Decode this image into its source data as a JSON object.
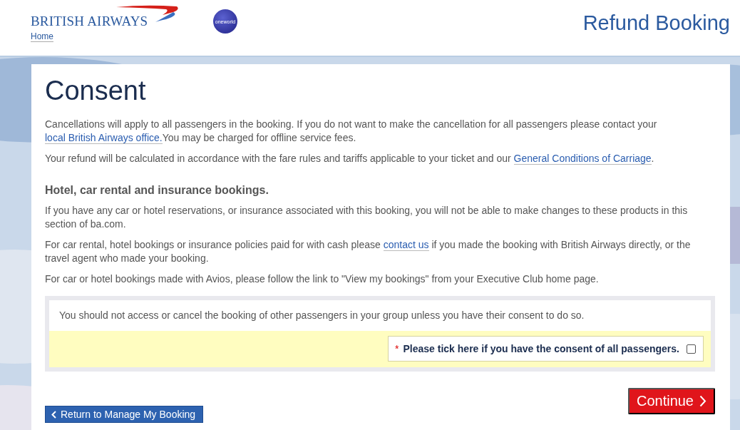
{
  "header": {
    "brand": "BRITISH AIRWAYS",
    "home_link": "Home",
    "alliance_badge": "oneworld",
    "page_title": "Refund Booking"
  },
  "heading": "Consent",
  "intro": [
    [
      {
        "text": "Cancellations will apply to all passengers in the booking. If you do not want to make the cancellation for all passengers please contact your "
      },
      {
        "link": "local British Airways office."
      },
      {
        "text": "You may be charged for offline service fees."
      }
    ],
    [
      {
        "text": "Your refund will be calculated in accordance with the fare rules and tariffs applicable to your ticket and our "
      },
      {
        "link": "General Conditions of Carriage"
      },
      {
        "text": "."
      }
    ]
  ],
  "section": {
    "title": "Hotel, car rental and insurance bookings.",
    "paragraphs": [
      [
        {
          "text": "If you have any car or hotel reservations, or insurance associated with this booking, you will not be able to make changes to these products in this section of ba.com."
        }
      ],
      [
        {
          "text": "For car rental, hotel bookings or insurance policies paid for with cash please "
        },
        {
          "link": "contact us"
        },
        {
          "text": " if you made the booking with British Airways directly, or the travel agent who made your booking."
        }
      ],
      [
        {
          "text": "For car or hotel bookings made with Avios, please follow the link to \"View my bookings\" from your Executive Club home page."
        }
      ]
    ]
  },
  "consent_box": {
    "notice": "You should not access or cancel the booking of other passengers in your group unless you have their consent to do so.",
    "required_mark": "*",
    "checkbox_label": "Please tick here if you have the consent of all passengers.",
    "checked": false
  },
  "buttons": {
    "back": "Return to Manage My Booking",
    "continue": "Continue"
  }
}
